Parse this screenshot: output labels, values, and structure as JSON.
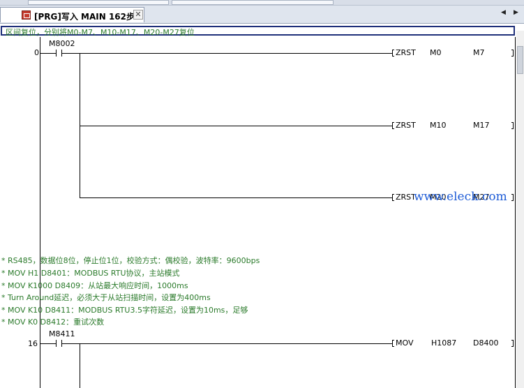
{
  "tab": {
    "title": "[PRG]写入 MAIN 162步",
    "close": "✕"
  },
  "nav": {
    "left": "◀",
    "right": "▶"
  },
  "header_comment": "区间复位，分别将M0-M7、M10-M17、M20-M27复位",
  "rung0": {
    "step": "0",
    "contact": "M8002",
    "instructions": [
      {
        "op": "ZRST",
        "arg1": "M0",
        "arg2": "M7"
      },
      {
        "op": "ZRST",
        "arg1": "M10",
        "arg2": "M17"
      },
      {
        "op": "ZRST",
        "arg1": "M20",
        "arg2": "M27"
      }
    ]
  },
  "comments": [
    "* RS485，数据位8位，停止位1位，校验方式：偶校验，波特率：9600bps",
    "* MOV H1   D8401：MODBUS RTU协议，主站模式",
    "* MOV K1000 D8409：从站最大响应时间，1000ms",
    "* Turn Around延迟，必须大于从站扫描时间，设置为400ms",
    "* MOV K10  D8411：MODBUS RTU3.5字符延迟，设置为10ms，足够",
    "* MOV K0   D8412：重试次数"
  ],
  "rung16": {
    "step": "16",
    "contact": "M8411",
    "instruction": {
      "op": "MOV",
      "arg1": "H1087",
      "arg2": "D8400"
    }
  },
  "watermark": "www.eleck.com"
}
